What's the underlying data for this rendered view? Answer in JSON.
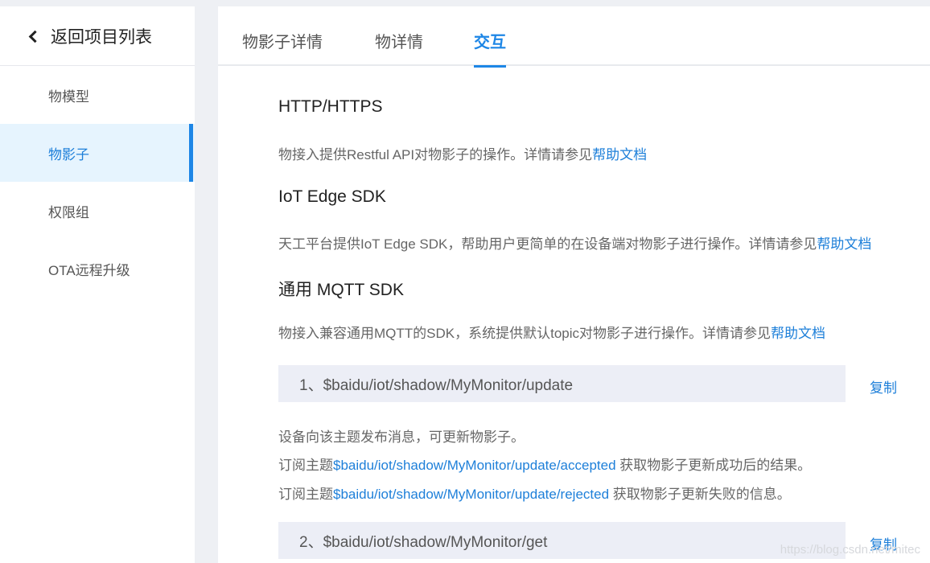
{
  "sidebar": {
    "back_label": "返回项目列表",
    "items": [
      {
        "label": "物模型"
      },
      {
        "label": "物影子"
      },
      {
        "label": "权限组"
      },
      {
        "label": "OTA远程升级"
      }
    ]
  },
  "tabs": [
    {
      "label": "物影子详情"
    },
    {
      "label": "物详情"
    },
    {
      "label": "交互"
    }
  ],
  "sections": {
    "http": {
      "title": "HTTP/HTTPS",
      "desc": "物接入提供Restful API对物影子的操作。详情请参见",
      "link": "帮助文档"
    },
    "iot_edge": {
      "title": "IoT Edge SDK",
      "desc": "天工平台提供IoT Edge SDK，帮助用户更简单的在设备端对物影子进行操作。详情请参见",
      "link": "帮助文档"
    },
    "mqtt": {
      "title": "通用 MQTT SDK",
      "desc": "物接入兼容通用MQTT的SDK，系统提供默认topic对物影子进行操作。详情请参见",
      "link": "帮助文档"
    }
  },
  "topics": [
    {
      "label": "1、$baidu/iot/shadow/MyMonitor/update",
      "copy_label": "复制",
      "line1": "设备向该主题发布消息，可更新物影子。",
      "line2_prefix": "订阅主题",
      "line2_link": "$baidu/iot/shadow/MyMonitor/update/accepted",
      "line2_suffix": " 获取物影子更新成功后的结果。",
      "line3_prefix": "订阅主题",
      "line3_link": "$baidu/iot/shadow/MyMonitor/update/rejected",
      "line3_suffix": " 获取物影子更新失败的信息。"
    },
    {
      "label": "2、$baidu/iot/shadow/MyMonitor/get",
      "copy_label": "复制"
    }
  ],
  "watermark": "https://blog.csdn.net/mitec"
}
